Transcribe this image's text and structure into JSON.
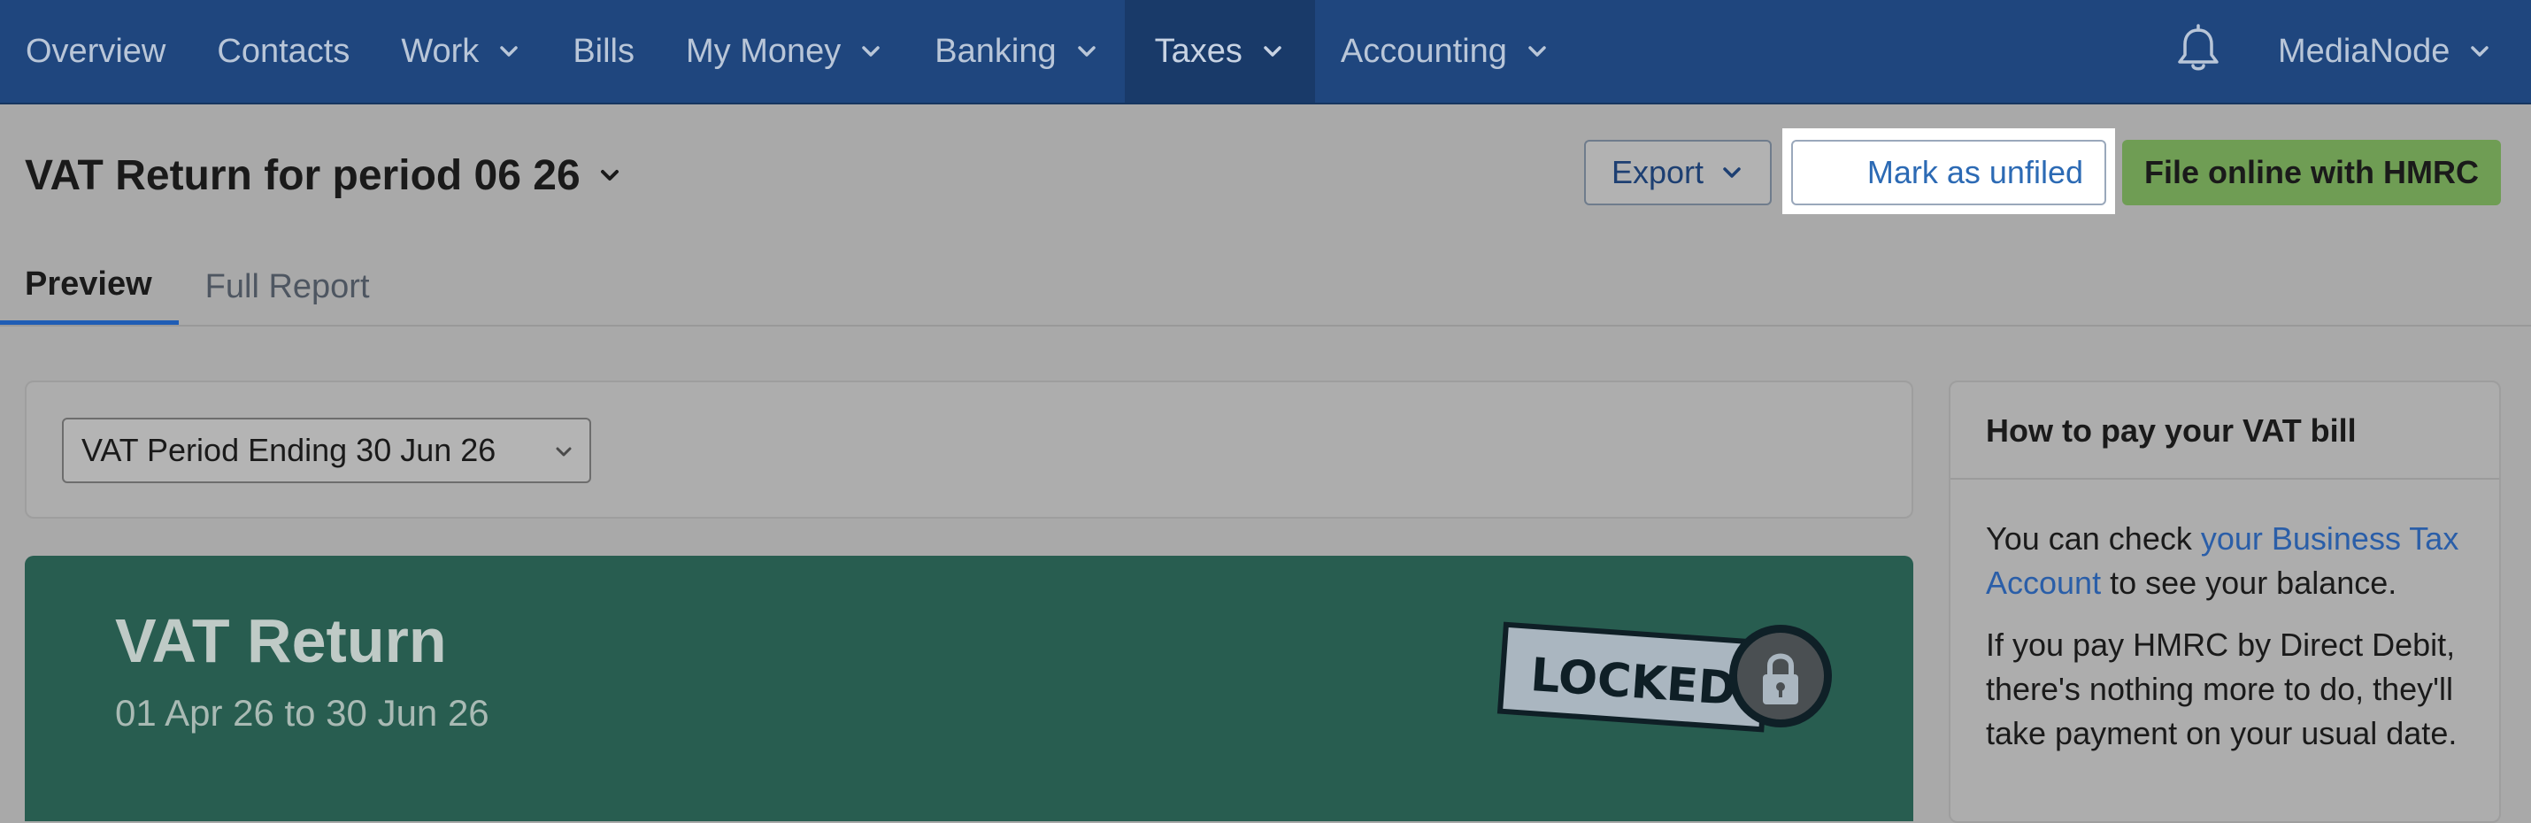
{
  "nav": {
    "items": [
      {
        "label": "Overview",
        "dropdown": false,
        "active": false
      },
      {
        "label": "Contacts",
        "dropdown": false,
        "active": false
      },
      {
        "label": "Work",
        "dropdown": true,
        "active": false
      },
      {
        "label": "Bills",
        "dropdown": false,
        "active": false
      },
      {
        "label": "My Money",
        "dropdown": true,
        "active": false
      },
      {
        "label": "Banking",
        "dropdown": true,
        "active": false
      },
      {
        "label": "Taxes",
        "dropdown": true,
        "active": true
      },
      {
        "label": "Accounting",
        "dropdown": true,
        "active": false
      }
    ],
    "bell_icon": "bell-icon",
    "user_label": "MediaNode"
  },
  "header": {
    "title": "VAT Return for period 06 26",
    "export_label": "Export",
    "mark_unfiled_label": "Mark as unfiled",
    "file_online_label": "File online with HMRC"
  },
  "tabs": [
    {
      "label": "Preview",
      "active": true
    },
    {
      "label": "Full Report",
      "active": false
    }
  ],
  "filter": {
    "selected_period": "VAT Period Ending 30 Jun 26"
  },
  "vat_return": {
    "title": "VAT Return",
    "date_range": "01 Apr 26 to 30 Jun 26",
    "locked_label": "LOCKED",
    "locked_icon": "padlock-icon"
  },
  "side_panel": {
    "title": "How to pay your VAT bill",
    "para1_prefix": "You can check ",
    "para1_link": "your Business Tax Account",
    "para1_suffix": " to see your balance.",
    "para2": "If you pay HMRC by Direct Debit, there's nothing more to do, they'll take payment on your usual date."
  },
  "colors": {
    "nav_bg": "#1f467e",
    "nav_active_bg": "#193a69",
    "banner_green": "#285d50",
    "hmrc_button_green": "#6f9d54",
    "link_blue": "#2a5ea8"
  }
}
